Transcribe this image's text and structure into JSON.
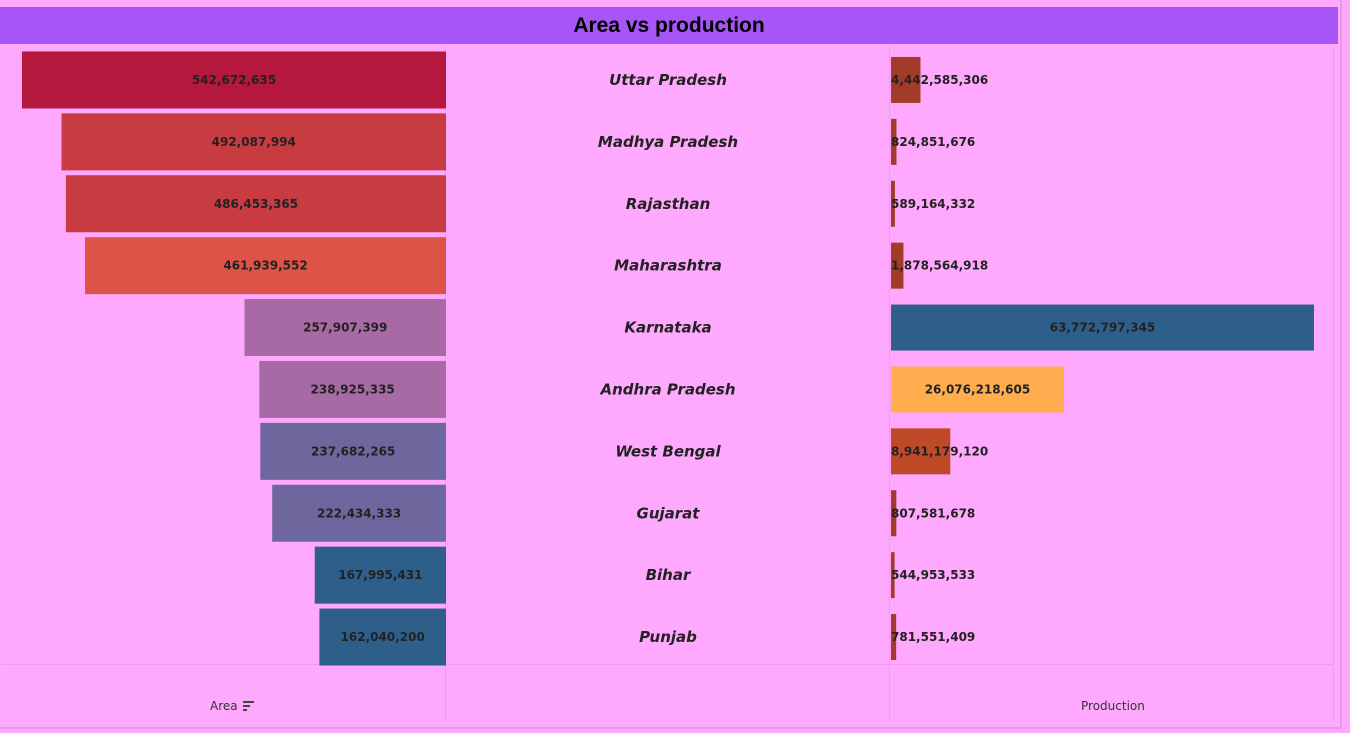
{
  "title": "Area vs production",
  "chart_data": {
    "type": "bar",
    "categories": [
      "Uttar Pradesh",
      "Madhya Pradesh",
      "Rajasthan",
      "Maharashtra",
      "Karnataka",
      "Andhra Pradesh",
      "West Bengal",
      "Gujarat",
      "Bihar",
      "Punjab"
    ],
    "series": [
      {
        "name": "Area",
        "values": [
          542672635,
          492087994,
          486453365,
          461939552,
          257907399,
          238925335,
          237682265,
          222434333,
          167995431,
          162040200
        ],
        "labels": [
          "542,672,635",
          "492,087,994",
          "486,453,365",
          "461,939,552",
          "257,907,399",
          "238,925,335",
          "237,682,265",
          "222,434,333",
          "167,995,431",
          "162,040,200"
        ],
        "colors": [
          "#B5173D",
          "#C73B41",
          "#C73B41",
          "#DD5347",
          "#A86AA4",
          "#A86AA4",
          "#6E679E",
          "#6E679E",
          "#2E5F8A",
          "#2E5F8A"
        ]
      },
      {
        "name": "Production",
        "values": [
          4442585306,
          824851676,
          589164332,
          1878564918,
          63772797345,
          26076218605,
          8941179120,
          807581678,
          544953533,
          781551409
        ],
        "labels": [
          "4,442,585,306",
          "824,851,676",
          "589,164,332",
          "1,878,564,918",
          "63,772,797,345",
          "26,076,218,605",
          "8,941,179,120",
          "807,581,678",
          "544,953,533",
          "781,551,409"
        ],
        "colors": [
          "#A23B27",
          "#A23B27",
          "#A23B27",
          "#A23B27",
          "#2E5F8A",
          "#FFAD4F",
          "#BF4A27",
          "#A23B27",
          "#A23B27",
          "#A23B27"
        ]
      }
    ],
    "xlabel_left": "Area",
    "xlabel_right": "Production",
    "sort_icon": "sort-descending-icon"
  }
}
